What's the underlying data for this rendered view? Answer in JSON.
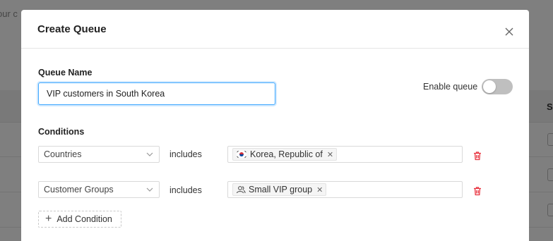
{
  "background": {
    "partial_text": "our c",
    "header_partial": "S"
  },
  "modal": {
    "title": "Create Queue",
    "close_icon": "close-icon"
  },
  "form": {
    "queue_name_label": "Queue Name",
    "queue_name_value": "VIP customers in South Korea",
    "enable_label": "Enable queue",
    "enable_on": false,
    "conditions_label": "Conditions",
    "conditions": [
      {
        "field": "Countries",
        "operator": "includes",
        "tag_icon": "south-korea-flag-icon",
        "tag": "Korea, Republic of"
      },
      {
        "field": "Customer Groups",
        "operator": "includes",
        "tag_icon": "user-group-icon",
        "tag": "Small VIP group"
      }
    ],
    "add_condition_label": "Add Condition"
  },
  "colors": {
    "accent": "#40a9ff",
    "danger": "#e8323e",
    "toggle_off": "#bfbfbf"
  }
}
